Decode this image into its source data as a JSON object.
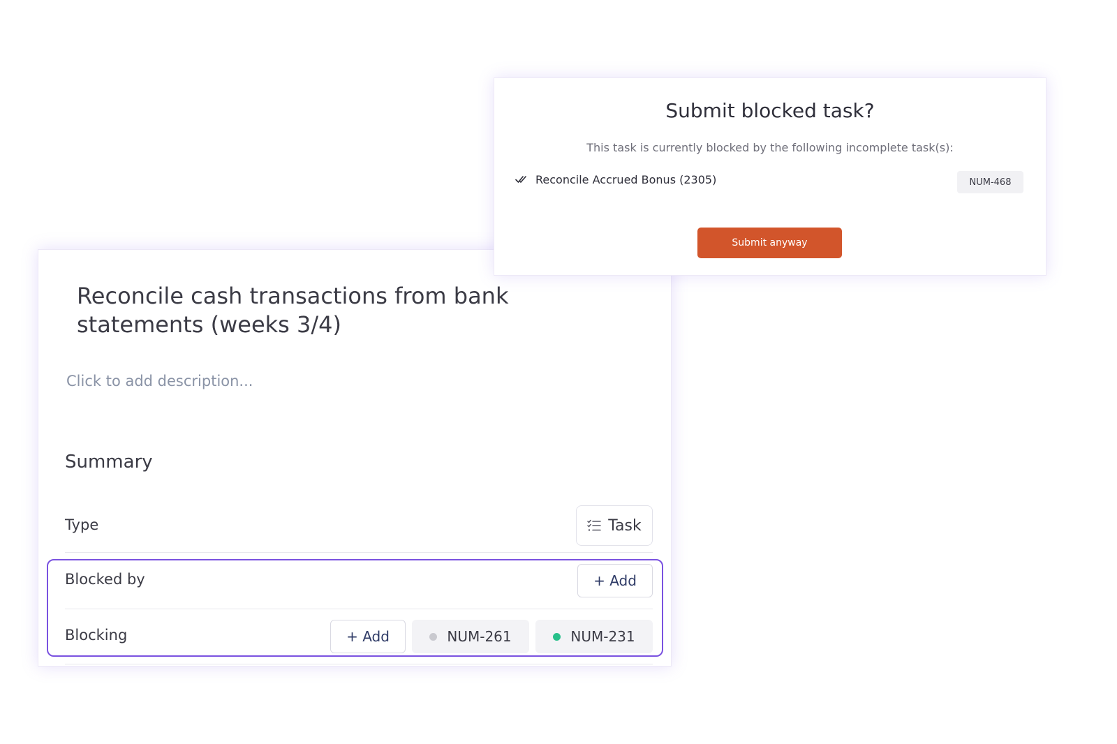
{
  "colors": {
    "accent_purple": "#7a52e0",
    "submit_orange": "#d2552b",
    "dot_gray": "#c9c9cf",
    "dot_green": "#27c08a"
  },
  "task": {
    "title": "Reconcile cash transactions from bank statements (weeks 3/4)",
    "description_placeholder": "Click to add description...",
    "summary_heading": "Summary",
    "type": {
      "label": "Type",
      "value": "Task",
      "icon": "checklist-icon"
    },
    "blocked_by": {
      "label": "Blocked by",
      "add_label": "+ Add"
    },
    "blocking": {
      "label": "Blocking",
      "add_label": "+ Add",
      "items": [
        {
          "id": "NUM-261",
          "status_color": "#c9c9cf"
        },
        {
          "id": "NUM-231",
          "status_color": "#27c08a"
        }
      ]
    }
  },
  "dialog": {
    "title": "Submit blocked task?",
    "message": "This task is currently blocked by the following incomplete task(s):",
    "blocking_task": {
      "icon": "double-check-icon",
      "name": "Reconcile Accrued Bonus (2305)",
      "id": "NUM-468"
    },
    "submit_label": "Submit anyway"
  }
}
